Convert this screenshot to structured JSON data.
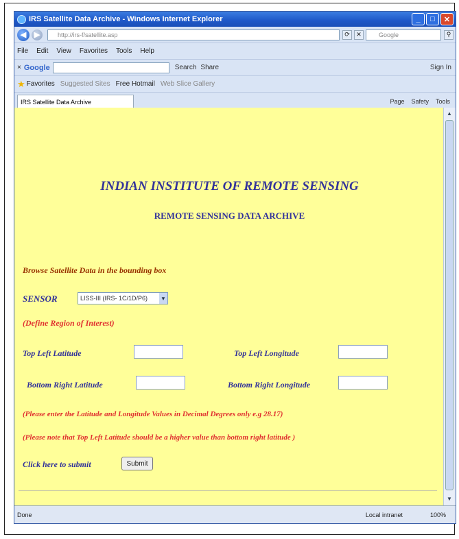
{
  "window": {
    "title": "IRS Satellite Data Archive - Windows Internet Explorer"
  },
  "toolbar": {
    "address": "http://irs-f/satellite.asp",
    "search_placeholder": "Google"
  },
  "menu": [
    "File",
    "Edit",
    "View",
    "Favorites",
    "Tools",
    "Help"
  ],
  "google_bar": {
    "logo": "Google",
    "search_label": "Search",
    "share_label": "Share",
    "signin_label": "Sign In"
  },
  "favorites_bar": {
    "favorites": "Favorites",
    "suggested": "Suggested Sites",
    "hotmail": "Free Hotmail",
    "gallery": "Web Slice Gallery"
  },
  "tab": {
    "label": "IRS Satellite Data Archive",
    "tools": [
      "Page",
      "Safety",
      "Tools"
    ]
  },
  "page": {
    "heading": "INDIAN INSTITUTE OF REMOTE SENSING",
    "subheading": "REMOTE SENSING DATA ARCHIVE",
    "browse_text": "Browse Satellite Data in the bounding box",
    "sensor_label": "SENSOR",
    "sensor_value": "LISS-III (IRS- 1C/1D/P6)",
    "roi_text": "(Define Region of Interest)",
    "top_left_lat": "Top Left Latitude",
    "top_left_lon": "Top Left Longitude",
    "bottom_right_lat": "Bottom Right Latitude",
    "bottom_right_lon": "Bottom Right Longitude",
    "note1": "(Please enter the Latitude and Longitude Values in Decimal Degrees only e.g 28.17)",
    "note2": "(Please note that Top Left Latitude should be a higher value than bottom right latitude )",
    "submit_prompt": "Click here to submit",
    "submit_button": "Submit"
  },
  "statusbar": {
    "status": "Done",
    "zone": "Local intranet",
    "zoom": "100%"
  }
}
